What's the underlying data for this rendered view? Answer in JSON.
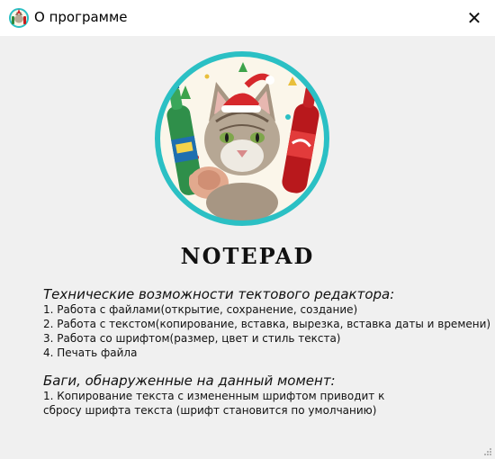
{
  "window": {
    "title": "О программе",
    "close_glyph": "✕",
    "app_icon": "notepad-cat-icon"
  },
  "logo": {
    "icon": "cat-with-soda-bottles-logo",
    "title": "NOTEPAD",
    "border_color": "#2bc0c4"
  },
  "features": {
    "heading": "Технические возможности тектового редактора:",
    "items": [
      "1. Работа с файлами(открытие, сохранение, создание)",
      "2. Работа с текстом(копирование, вставка, вырезка, вставка даты и времени)",
      "3. Работа со шрифтом(размер, цвет и стиль текста)",
      "4. Печать файла"
    ]
  },
  "bugs": {
    "heading": "Баги, обнаруженные на данный момент:",
    "items": [
      "1. Копирование текста с измененным шрифтом приводит к",
      "сбросу шрифта текста (шрифт становится по умолчанию)"
    ]
  }
}
